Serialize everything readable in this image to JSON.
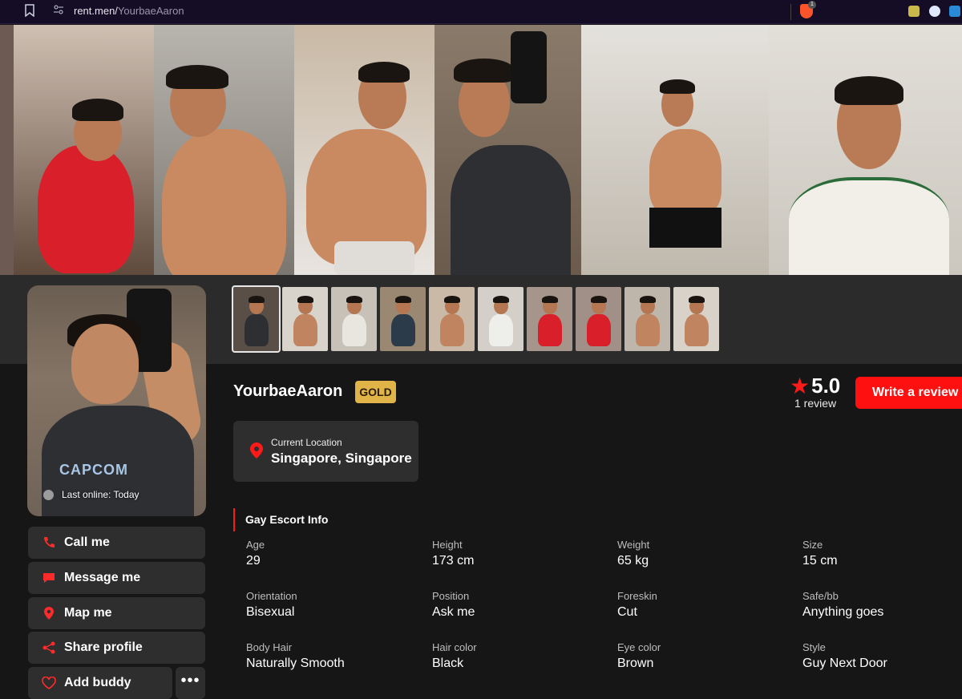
{
  "browser": {
    "url_host": "rent.men/",
    "url_path": "YourbaeAaron",
    "brave_badge": "1"
  },
  "profile": {
    "name": "YourbaeAaron",
    "tier": "GOLD",
    "rating": "5.0",
    "reviews": "1 review",
    "write_review": "Write a review",
    "last_online": "Last online: Today",
    "jersey_text": "CAPCOM"
  },
  "location": {
    "label": "Current Location",
    "value": "Singapore, Singapore"
  },
  "actions": {
    "call": "Call me",
    "message": "Message me",
    "map": "Map me",
    "share": "Share profile",
    "buddy": "Add buddy",
    "more": "•••"
  },
  "info": {
    "title": "Gay Escort Info",
    "fields": [
      {
        "k": "Age",
        "v": "29"
      },
      {
        "k": "Height",
        "v": "173 cm"
      },
      {
        "k": "Weight",
        "v": "65 kg"
      },
      {
        "k": "Size",
        "v": "15 cm"
      },
      {
        "k": "Orientation",
        "v": "Bisexual"
      },
      {
        "k": "Position",
        "v": "Ask me"
      },
      {
        "k": "Foreskin",
        "v": "Cut"
      },
      {
        "k": "Safe/bb",
        "v": "Anything goes"
      },
      {
        "k": "Body Hair",
        "v": "Naturally Smooth"
      },
      {
        "k": "Hair color",
        "v": "Black"
      },
      {
        "k": "Eye color",
        "v": "Brown"
      },
      {
        "k": "Style",
        "v": "Guy Next Door"
      }
    ]
  },
  "colors": {
    "accent": "#ff1a1a",
    "gold": "#e1b44a",
    "panel": "#2e2e2e",
    "background": "#161616"
  }
}
